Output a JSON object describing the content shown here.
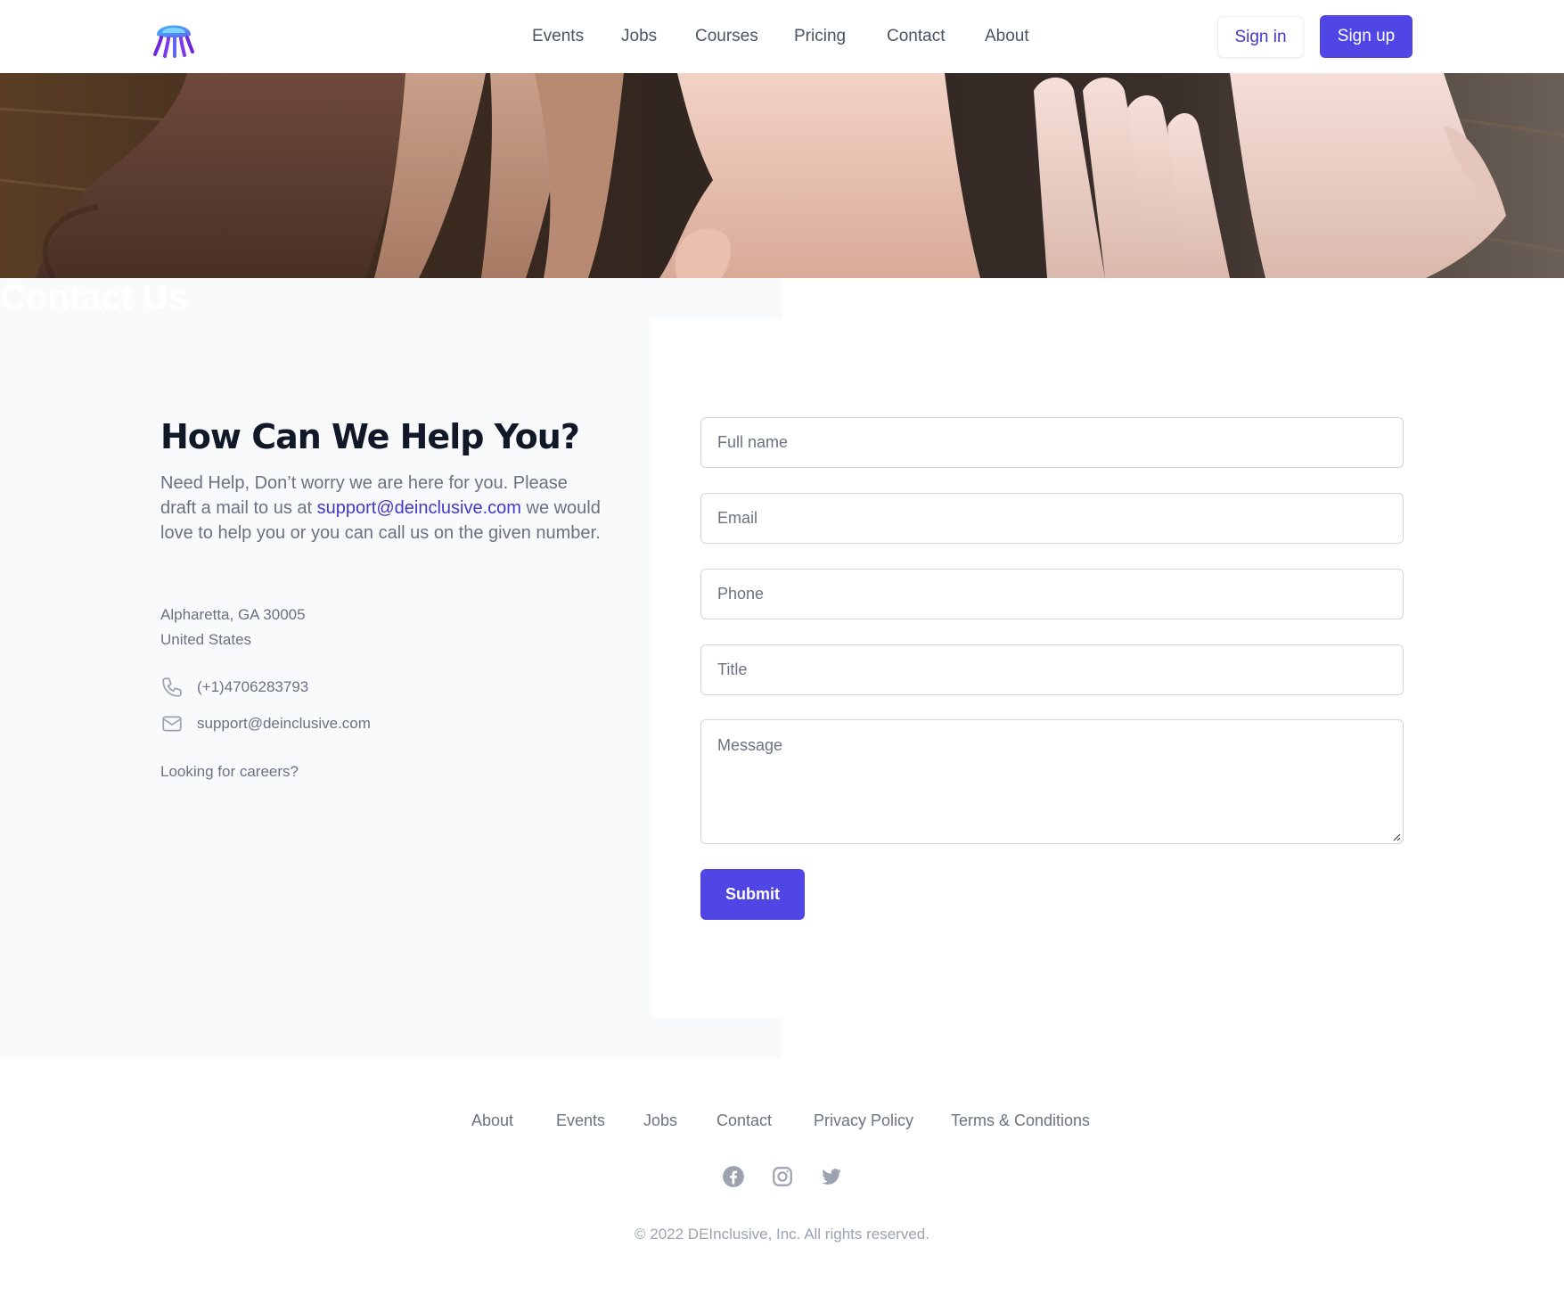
{
  "header": {
    "nav": [
      "Events",
      "Jobs",
      "Courses",
      "Pricing",
      "Contact",
      "About"
    ],
    "sign_in": "Sign in",
    "sign_up": "Sign up"
  },
  "hero": {
    "title": "Contact Us"
  },
  "info": {
    "title": "How Can We Help You?",
    "intro_before": "Need Help, Don’t worry we are here for you. Please draft a mail to us at ",
    "intro_email": "support@deinclusive.com",
    "intro_after": " we would love to help you or you can call us on the given number.",
    "address_line1": "Alpharetta, GA 30005",
    "address_line2": "United States",
    "phone": "(+1)4706283793",
    "email": "support@deinclusive.com",
    "careers": "Looking for careers?"
  },
  "form": {
    "full_name_placeholder": "Full name",
    "email_placeholder": "Email",
    "phone_placeholder": "Phone",
    "title_placeholder": "Title",
    "message_placeholder": "Message",
    "submit": "Submit"
  },
  "footer": {
    "links": [
      "About",
      "Events",
      "Jobs",
      "Contact",
      "Privacy Policy",
      "Terms & Conditions"
    ],
    "social_icons": [
      "facebook-icon",
      "instagram-icon",
      "twitter-icon"
    ],
    "copyright": "© 2022 DEInclusive, Inc. All rights reserved."
  },
  "colors": {
    "accent": "#4f46e5",
    "link": "#4338ca",
    "panel": "#f8fafc"
  }
}
